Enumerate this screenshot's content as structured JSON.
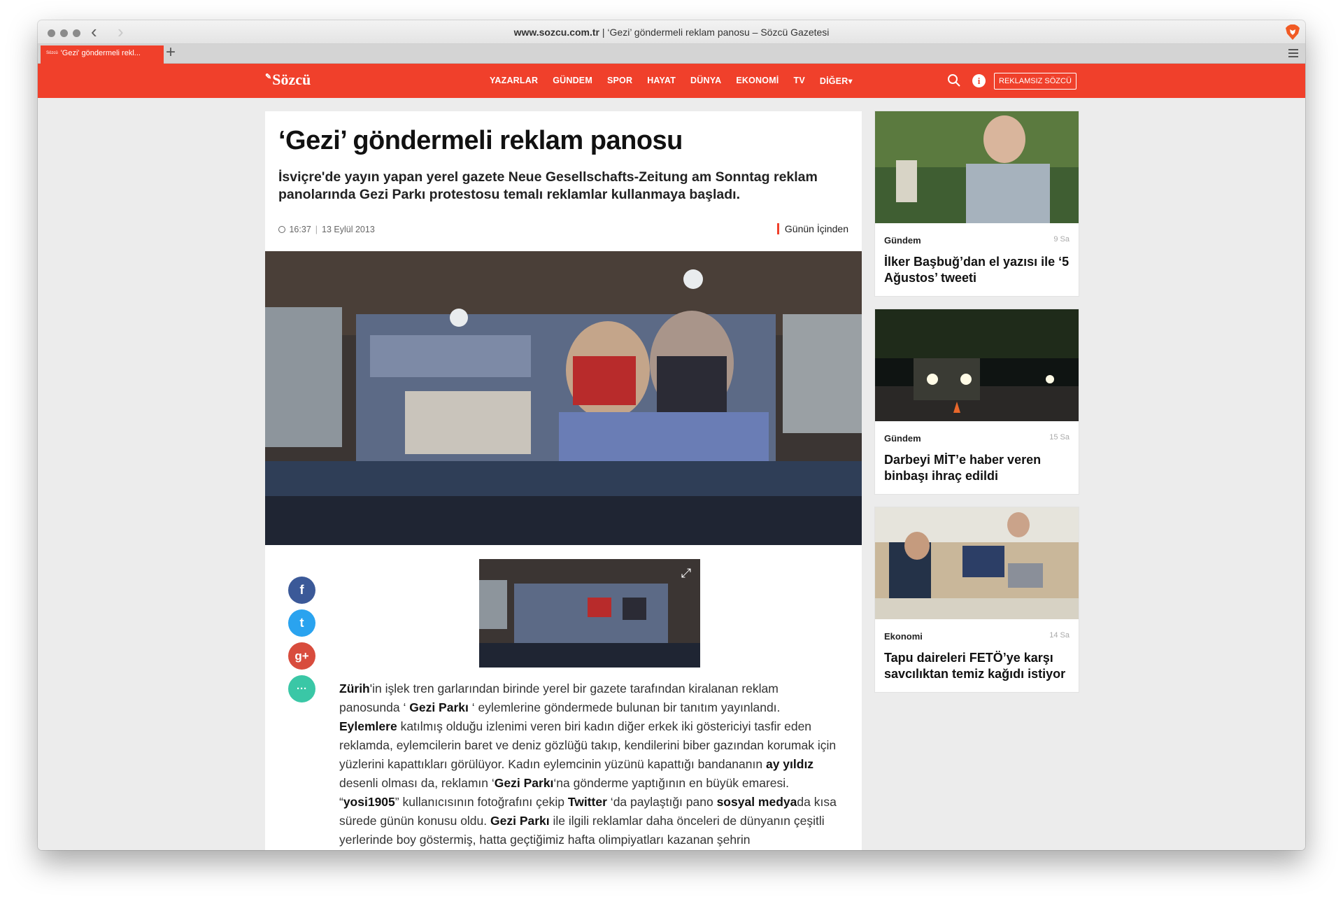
{
  "browser": {
    "url": "www.sozcu.com.tr",
    "title_sep": " | ",
    "title": "‘Gezi’ göndermeli reklam panosu – Sözcü Gazetesi",
    "tab_favicon": "Sözcü",
    "tab_label": "'Gezi' göndermeli rekl...",
    "new_tab": "+"
  },
  "header": {
    "logo": "Sözcü",
    "nav": [
      "YAZARLAR",
      "GÜNDEM",
      "SPOR",
      "HAYAT",
      "DÜNYA",
      "EKONOMİ",
      "TV",
      "DİĞER▾"
    ],
    "info_icon": "i",
    "adfree_button": "REKLAMSIZ SÖZCÜ"
  },
  "article": {
    "headline": "‘Gezi’ göndermeli reklam panosu",
    "lead": "İsviçre'de yayın yapan yerel gazete Neue Gesellschafts-Zeitung am Sonntag reklam panolarında Gezi Parkı protestosu temalı reklamlar kullanmaya başladı.",
    "time": "16:37",
    "date": "13 Eylül 2013",
    "category": "Günün İçinden",
    "body": [
      {
        "t": "Zürih",
        "b": true
      },
      {
        "t": "'in işlek tren garlarından birinde yerel bir gazete tarafından kiralanan reklam panosunda ‘ ",
        "b": false
      },
      {
        "t": "Gezi Parkı",
        "b": true
      },
      {
        "t": " ‘ eylemlerine göndermede bulunan bir tanıtım yayınlandı. ",
        "b": false
      },
      {
        "t": "Eylemlere",
        "b": true
      },
      {
        "t": " katılmış olduğu izlenimi veren biri kadın diğer erkek iki göstericiyi tasfir eden reklamda, eylemcilerin baret ve deniz gözlüğü takıp, kendilerini biber gazından korumak için yüzlerini kapattıkları görülüyor. Kadın eylemcinin yüzünü kapattığı bandananın ",
        "b": false
      },
      {
        "t": "ay yıldız",
        "b": true
      },
      {
        "t": " desenli olması da, reklamın ‘",
        "b": false
      },
      {
        "t": "Gezi Parkı",
        "b": true
      },
      {
        "t": "‘na gönderme yaptığının en büyük emaresi. “",
        "b": false
      },
      {
        "t": "yosi1905",
        "b": true
      },
      {
        "t": "” kullanıcısının fotoğrafını çekip ",
        "b": false
      },
      {
        "t": "Twitter",
        "b": true
      },
      {
        "t": " ‘da paylaştığı pano ",
        "b": false
      },
      {
        "t": "sosyal medya",
        "b": true
      },
      {
        "t": "da kısa sürede günün konusu oldu. ",
        "b": false
      },
      {
        "t": "Gezi Parkı",
        "b": true
      },
      {
        "t": " ile ilgili reklamlar daha önceleri de dünyanın çeşitli yerlerinde boy göstermiş, hatta geçtiğimiz hafta olimpiyatları kazanan şehrin",
        "b": false
      }
    ],
    "social": {
      "facebook": "f",
      "twitter": "t",
      "googleplus": "g+",
      "more": "···"
    }
  },
  "sidebar": [
    {
      "category": "Gündem",
      "ago": "9 Sa",
      "title": "İlker Başbuğ’dan el yazısı ile ‘5 Ağustos’ tweeti"
    },
    {
      "category": "Gündem",
      "ago": "15 Sa",
      "title": "Darbeyi MİT’e haber veren binbaşı ihraç edildi"
    },
    {
      "category": "Ekonomi",
      "ago": "14 Sa",
      "title": "Tapu daireleri FETÖ’ye karşı savcılıktan temiz kağıdı istiyor"
    }
  ],
  "colors": {
    "brand": "#f0402b",
    "page_bg": "#ececec"
  }
}
